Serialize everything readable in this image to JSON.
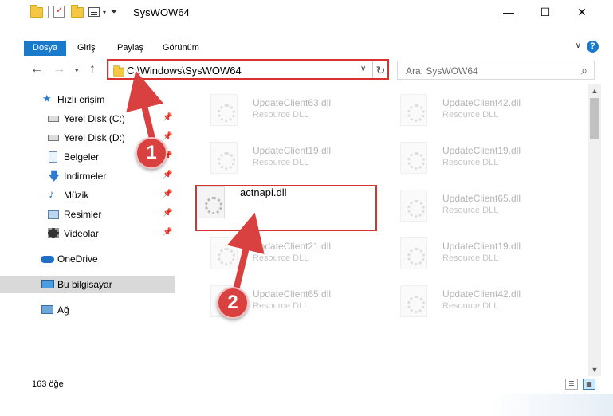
{
  "window": {
    "title": "SysWOW64",
    "minimize_glyph": "—",
    "maximize_glyph": "☐",
    "close_glyph": "✕"
  },
  "ribbon": {
    "tabs": [
      {
        "label": "Dosya",
        "active": true
      },
      {
        "label": "Giriş"
      },
      {
        "label": "Paylaş"
      },
      {
        "label": "Görünüm"
      }
    ],
    "help_glyph": "?",
    "expand_glyph": "∨"
  },
  "address": {
    "path": "C:\\Windows\\SysWOW64",
    "search_placeholder": "Ara: SysWOW64"
  },
  "nav": {
    "items": [
      {
        "label": "Hızlı erişim",
        "icon": "star-icon"
      },
      {
        "label": "Yerel Disk (C:)",
        "icon": "drive-icon",
        "pinned": true
      },
      {
        "label": "Yerel Disk (D:)",
        "icon": "drive-icon",
        "pinned": true
      },
      {
        "label": "Belgeler",
        "icon": "documents-icon",
        "pinned": true
      },
      {
        "label": "İndirmeler",
        "icon": "download-icon",
        "pinned": true
      },
      {
        "label": "Müzik",
        "icon": "music-icon",
        "pinned": true
      },
      {
        "label": "Resimler",
        "icon": "pictures-icon",
        "pinned": true
      },
      {
        "label": "Videolar",
        "icon": "video-icon",
        "pinned": true
      },
      {
        "label": "OneDrive",
        "icon": "cloud-icon"
      },
      {
        "label": "Bu bilgisayar",
        "icon": "computer-icon",
        "selected": true
      },
      {
        "label": "Ağ",
        "icon": "network-icon"
      }
    ],
    "pin_glyph": "📌"
  },
  "files": {
    "left": [
      {
        "name": "UpdateClient63.dll",
        "desc": "Resource DLL"
      },
      {
        "name": "UpdateClient19.dll",
        "desc": "Resource DLL"
      },
      {
        "name": "actnapi.dll",
        "desc": ""
      },
      {
        "name": "UpdateClient21.dll",
        "desc": "Resource DLL"
      },
      {
        "name": "UpdateClient65.dll",
        "desc": "Resource DLL"
      }
    ],
    "right": [
      {
        "name": "UpdateClient42.dll",
        "desc": "Resource DLL"
      },
      {
        "name": "UpdateClient19.dll",
        "desc": "Resource DLL"
      },
      {
        "name": "UpdateClient65.dll",
        "desc": "Resource DLL"
      },
      {
        "name": "UpdateClient19.dll",
        "desc": "Resource DLL"
      },
      {
        "name": "UpdateClient42.dll",
        "desc": "Resource DLL"
      }
    ]
  },
  "annotations": {
    "step1": "1",
    "step2": "2",
    "color": "#d94040"
  },
  "status": {
    "count": "163 öğe"
  }
}
